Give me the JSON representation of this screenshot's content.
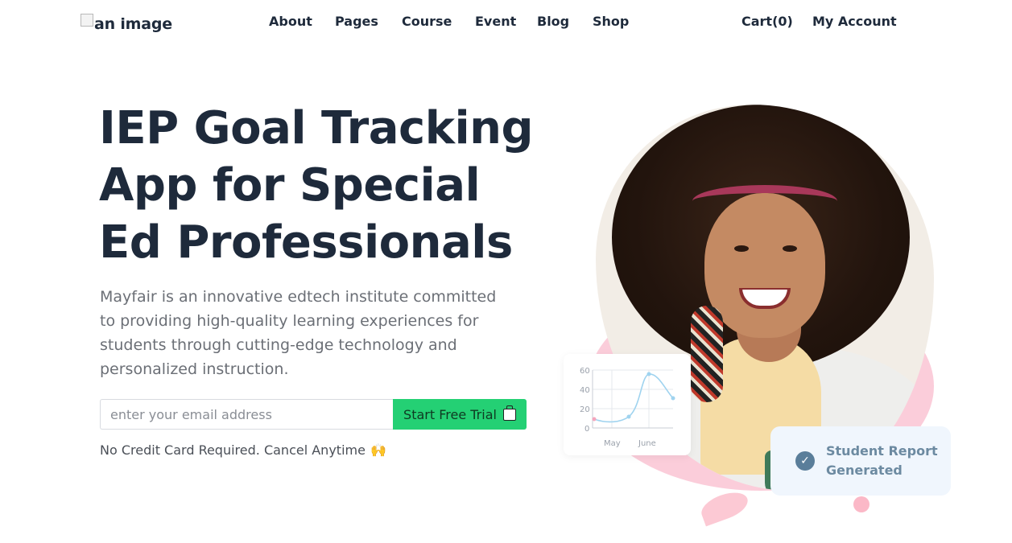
{
  "header": {
    "logo_alt": "an image",
    "nav": [
      "About",
      "Pages",
      "Course",
      "Event",
      "Blog",
      "Shop"
    ],
    "cart": "Cart(0)",
    "account": "My Account"
  },
  "hero": {
    "title_lines": [
      "IEP Goal Tracking",
      "App for Special",
      "Ed Professionals"
    ],
    "description_lines": [
      "Mayfair is an innovative edtech institute committed",
      "to providing high-quality learning experiences for",
      "students through cutting-edge technology and",
      "personalized instruction."
    ],
    "email_placeholder": "enter your email address",
    "cta_label": "Start Free Trial",
    "note": "No Credit Card Required. Cancel Anytime",
    "note_emoji": "🙌"
  },
  "chart_card": {
    "y_ticks": [
      "60",
      "40",
      "20",
      "0"
    ],
    "x_ticks": [
      "May",
      "June"
    ]
  },
  "report_card": {
    "lines": [
      "Student Report",
      "Generated"
    ]
  },
  "colors": {
    "text": "#1e2a3b",
    "cta": "#24d074",
    "pink": "#fbc8d6",
    "report_bg": "#f0f6fd",
    "report_text": "#6c8aa1"
  }
}
